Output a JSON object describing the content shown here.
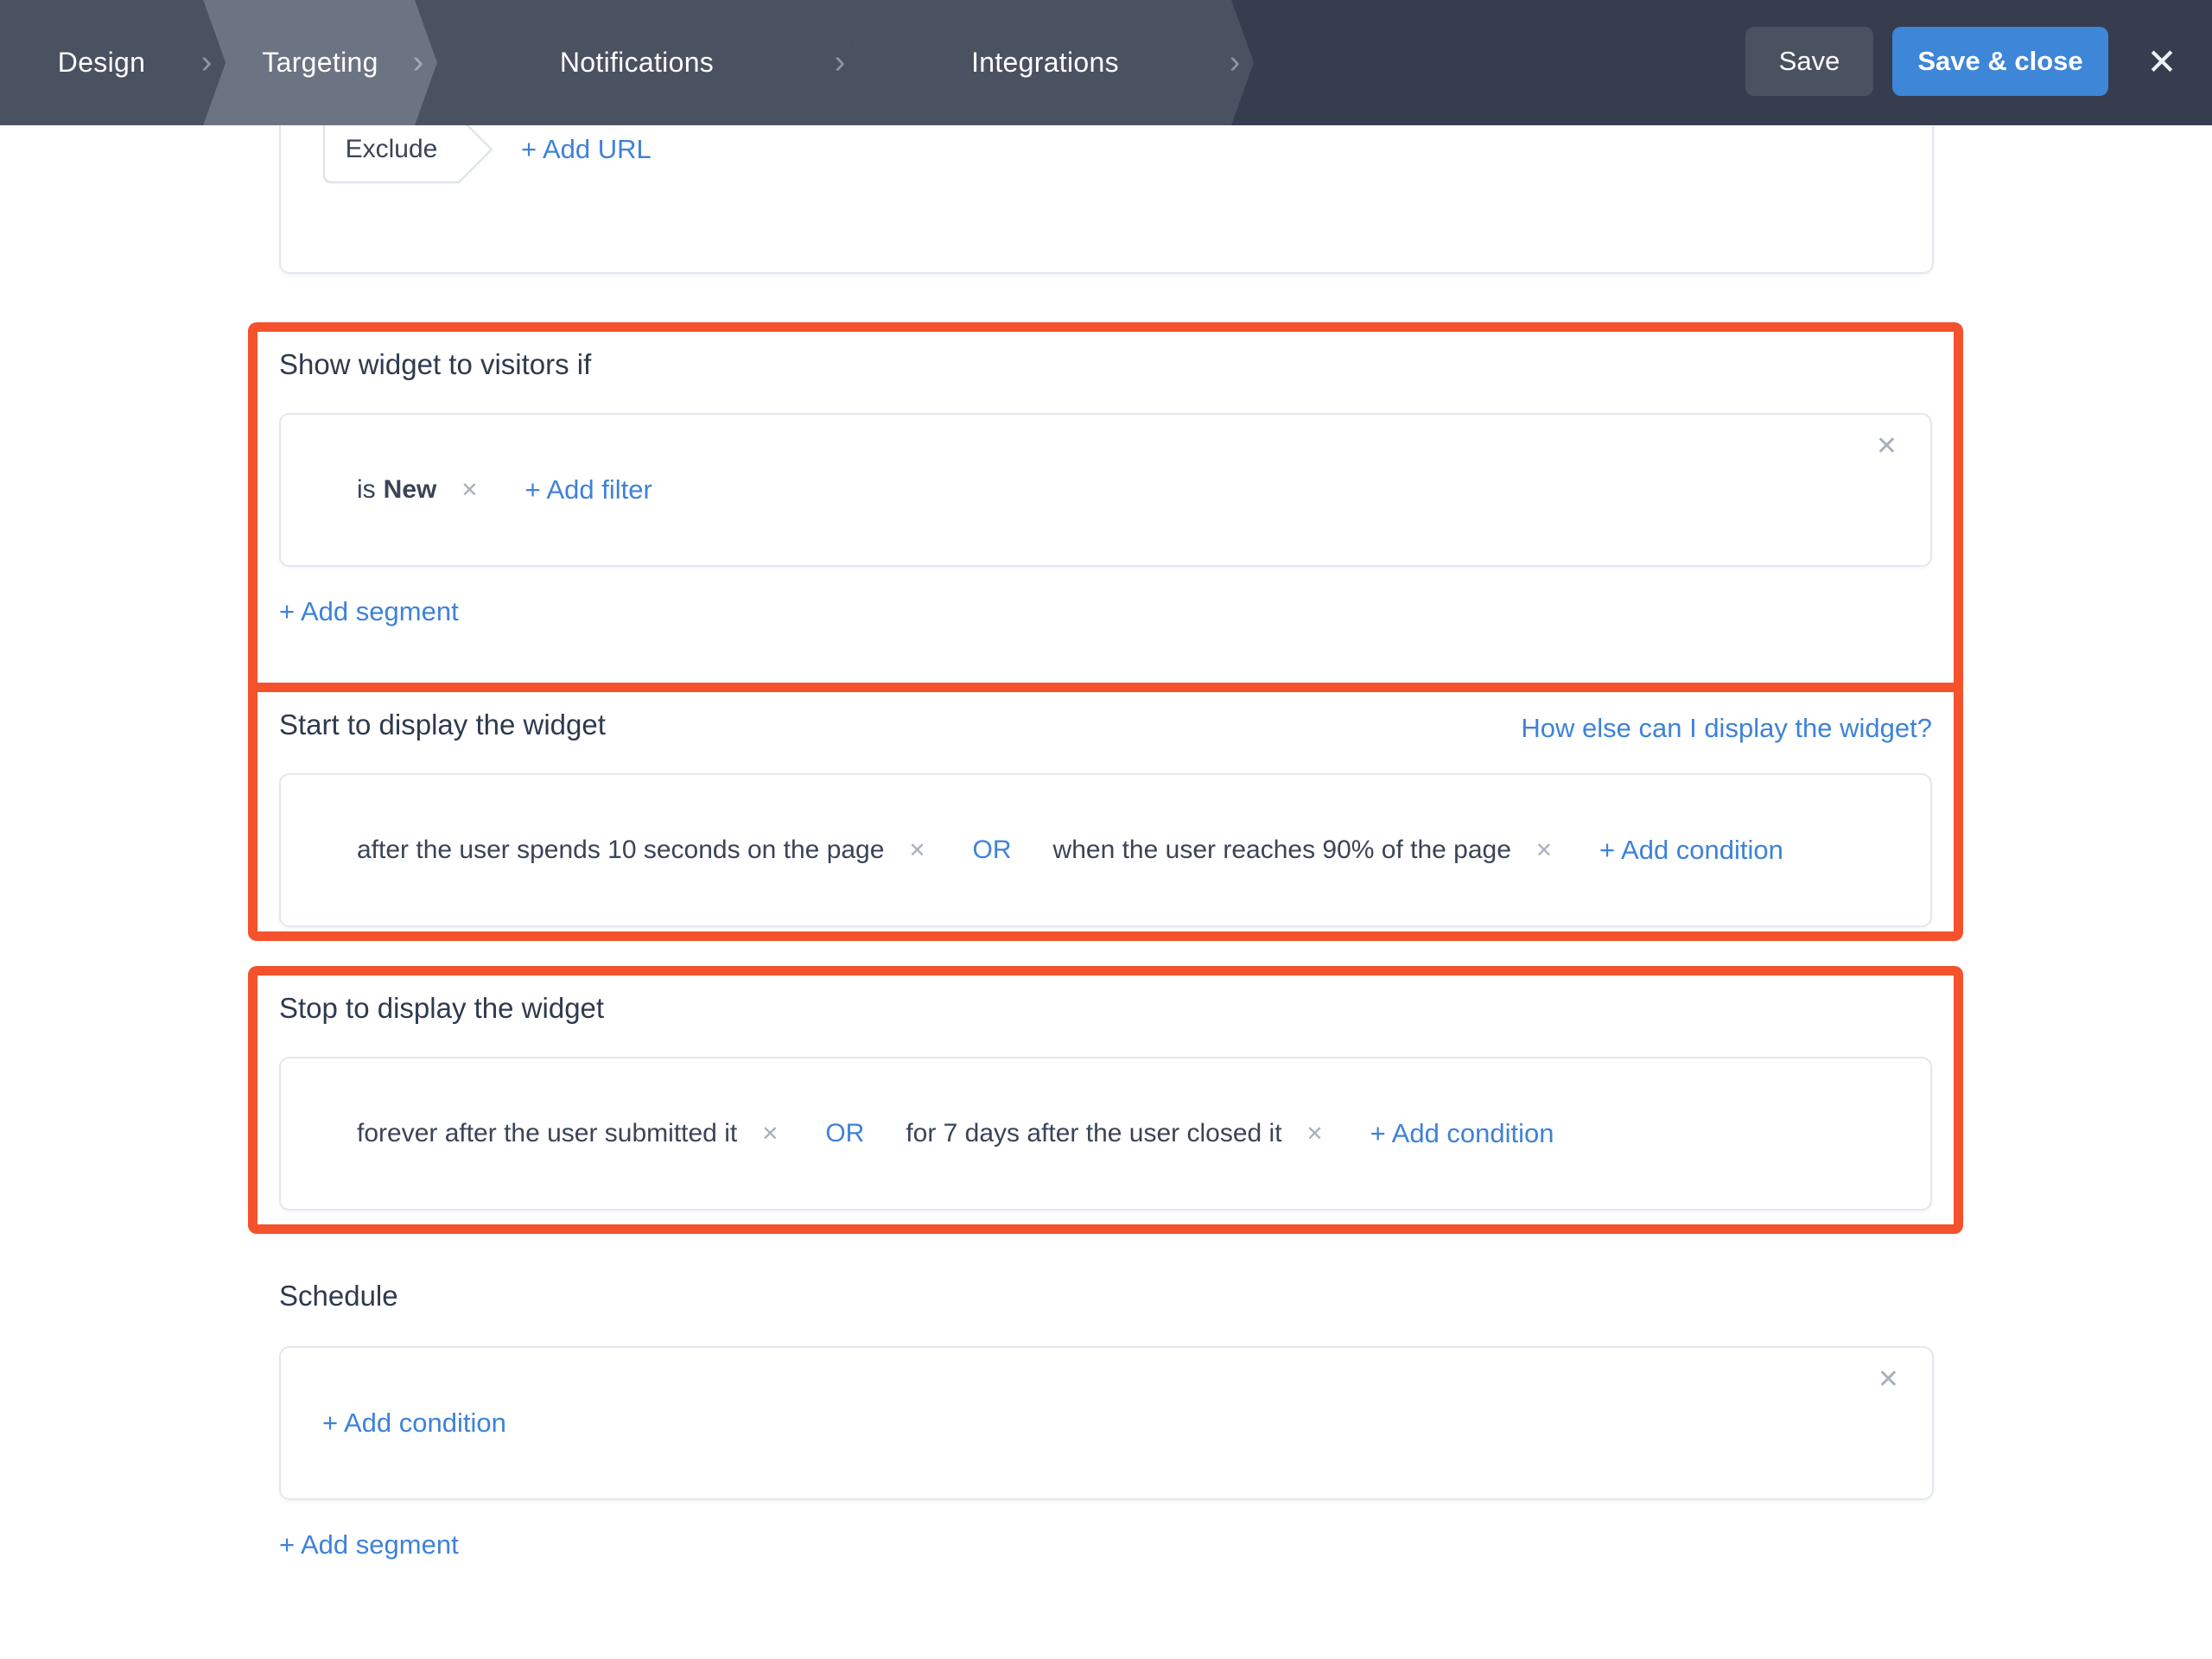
{
  "colors": {
    "accent_blue": "#3E86D8",
    "link_blue": "#3E82D8",
    "highlight_orange": "#F4512C",
    "topbar_bg": "#353D4F"
  },
  "icons": {
    "remove": "✕",
    "close": "✕",
    "tab_separator": "›"
  },
  "header": {
    "tabs": [
      {
        "label": "Design"
      },
      {
        "label": "Targeting"
      },
      {
        "label": "Notifications"
      },
      {
        "label": "Integrations"
      }
    ],
    "active_tab": "Targeting",
    "save_label": "Save",
    "save_close_label": "Save & close"
  },
  "url_card": {
    "exclude_label": "Exclude",
    "add_url_label": "+ Add URL"
  },
  "sections": {
    "visitors": {
      "title": "Show widget to visitors if",
      "segment_prefix": "is",
      "segment_value": "New",
      "add_filter_label": "+ Add filter",
      "add_segment_label": "+ Add segment"
    },
    "start": {
      "title": "Start to display the widget",
      "help_link": "How else can I display the widget?",
      "conditions": [
        "after the user spends 10 seconds on the page",
        "when the user reaches 90% of the page"
      ],
      "or_label": "OR",
      "add_condition_label": "+ Add condition"
    },
    "stop": {
      "title": "Stop to display the widget",
      "conditions": [
        "forever after the user submitted it",
        "for 7 days after the user closed it"
      ],
      "or_label": "OR",
      "add_condition_label": "+ Add condition"
    },
    "schedule": {
      "title": "Schedule",
      "add_condition_label": "+ Add condition",
      "add_segment_label": "+ Add segment"
    }
  }
}
